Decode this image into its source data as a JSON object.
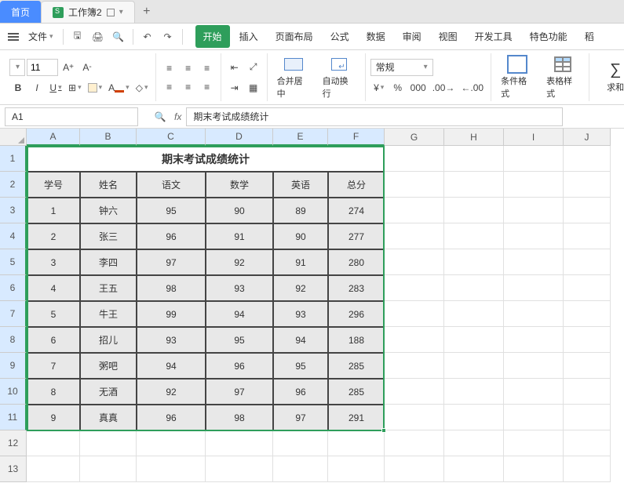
{
  "tabs": {
    "home": "首页",
    "doc": "工作簿2"
  },
  "file_menu": "文件",
  "menus": {
    "start": "开始",
    "insert": "插入",
    "layout": "页面布局",
    "formula": "公式",
    "data": "数据",
    "review": "审阅",
    "view": "视图",
    "dev": "开发工具",
    "special": "特色功能",
    "more": "稻"
  },
  "ribbon": {
    "font_size": "11",
    "merge_label": "合并居中",
    "wrap_label": "自动换行",
    "format_general": "常规",
    "cond_format": "条件格式",
    "table_style": "表格样式",
    "sum": "求和"
  },
  "formula_bar": {
    "cell_ref": "A1",
    "fx": "fx",
    "content": "期末考试成绩统计"
  },
  "columns": [
    "A",
    "B",
    "C",
    "D",
    "E",
    "F",
    "G",
    "H",
    "I",
    "J"
  ],
  "sheet": {
    "title": "期末考试成绩统计",
    "headers": [
      "学号",
      "姓名",
      "语文",
      "数学",
      "英语",
      "总分"
    ],
    "rows": [
      [
        "1",
        "钟六",
        "95",
        "90",
        "89",
        "274"
      ],
      [
        "2",
        "张三",
        "96",
        "91",
        "90",
        "277"
      ],
      [
        "3",
        "李四",
        "97",
        "92",
        "91",
        "280"
      ],
      [
        "4",
        "王五",
        "98",
        "93",
        "92",
        "283"
      ],
      [
        "5",
        "牛王",
        "99",
        "94",
        "93",
        "296"
      ],
      [
        "6",
        "招儿",
        "93",
        "95",
        "94",
        "188"
      ],
      [
        "7",
        "粥吧",
        "94",
        "96",
        "95",
        "285"
      ],
      [
        "8",
        "无酒",
        "92",
        "97",
        "96",
        "285"
      ],
      [
        "9",
        "真真",
        "96",
        "98",
        "97",
        "291"
      ]
    ]
  },
  "chart_data": {
    "type": "table",
    "title": "期末考试成绩统计",
    "columns": [
      "学号",
      "姓名",
      "语文",
      "数学",
      "英语",
      "总分"
    ],
    "rows": [
      [
        1,
        "钟六",
        95,
        90,
        89,
        274
      ],
      [
        2,
        "张三",
        96,
        91,
        90,
        277
      ],
      [
        3,
        "李四",
        97,
        92,
        91,
        280
      ],
      [
        4,
        "王五",
        98,
        93,
        92,
        283
      ],
      [
        5,
        "牛王",
        99,
        94,
        93,
        296
      ],
      [
        6,
        "招儿",
        93,
        95,
        94,
        188
      ],
      [
        7,
        "粥吧",
        94,
        96,
        95,
        285
      ],
      [
        8,
        "无酒",
        92,
        97,
        96,
        285
      ],
      [
        9,
        "真真",
        96,
        98,
        97,
        291
      ]
    ]
  }
}
